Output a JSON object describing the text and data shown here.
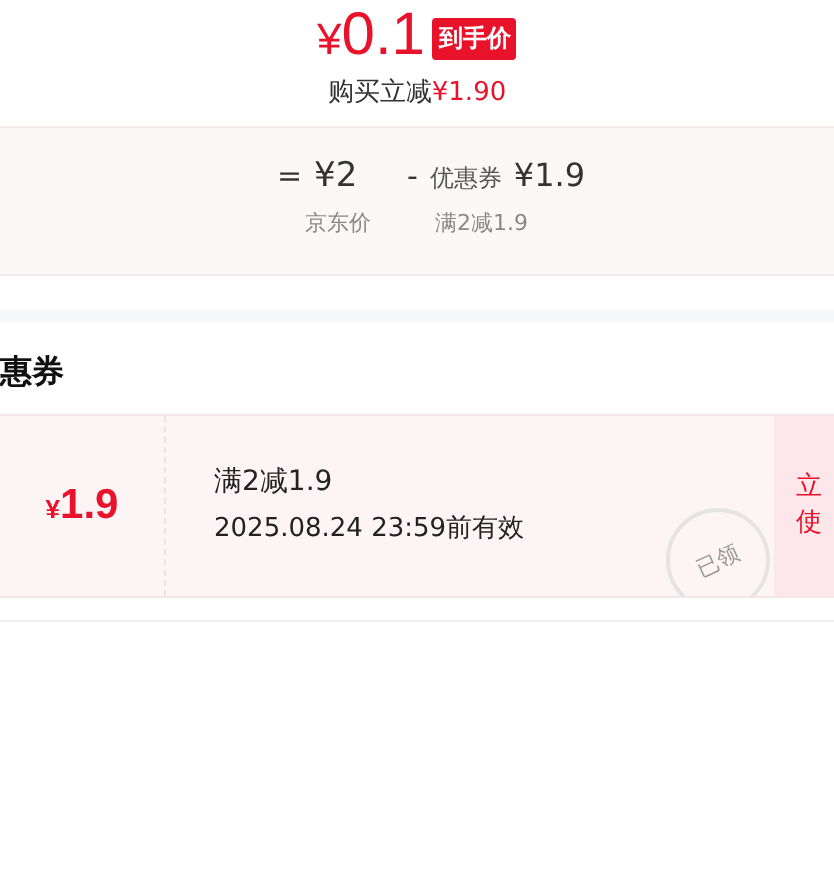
{
  "price": {
    "currency": "¥",
    "amount": "0.1",
    "badge": "到手价"
  },
  "saving": {
    "label": "购买立减",
    "amount": "¥1.90"
  },
  "breakdown": [
    {
      "op": "=",
      "value": "¥2",
      "caption": "京东价"
    },
    {
      "op": "-",
      "prefix": "优惠券",
      "value": "¥1.9",
      "caption": "满2减1.9"
    }
  ],
  "section_title": "惠券",
  "coupon": {
    "currency": "¥",
    "amount": "1.9",
    "condition": "满2减1.9",
    "validity": "2025.08.24 23:59前有效",
    "stamp": "已领",
    "button_lines": [
      "立",
      "使"
    ]
  }
}
